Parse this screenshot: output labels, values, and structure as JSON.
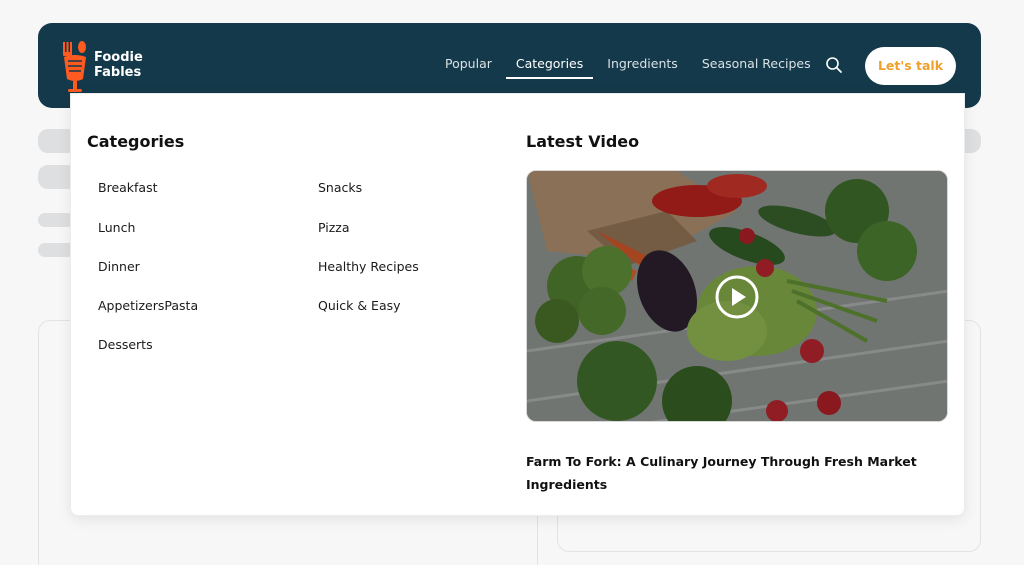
{
  "brand": {
    "name_line1": "Foodie",
    "name_line2": "Fables",
    "accent": "#ff5a1f",
    "header_bg": "#14394a"
  },
  "nav": {
    "items": [
      {
        "label": "Popular"
      },
      {
        "label": "Categories"
      },
      {
        "label": "Ingredients"
      },
      {
        "label": "Seasonal Recipes"
      }
    ],
    "active": "Categories",
    "search_icon": "search-icon",
    "cta_label": "Let's talk",
    "cta_color": "#f0a02a"
  },
  "dropdown": {
    "categories_heading": "Categories",
    "categories_col1": [
      "Breakfast",
      "Lunch",
      "Dinner",
      "AppetizersPasta",
      "Desserts"
    ],
    "categories_col2": [
      "Snacks",
      "Pizza",
      "Healthy Recipes",
      "Quick & Easy"
    ],
    "video_heading": "Latest Video",
    "video_icon": "play-icon",
    "video_title": "Farm To Fork: A Culinary Journey Through Fresh Market Ingredients"
  }
}
